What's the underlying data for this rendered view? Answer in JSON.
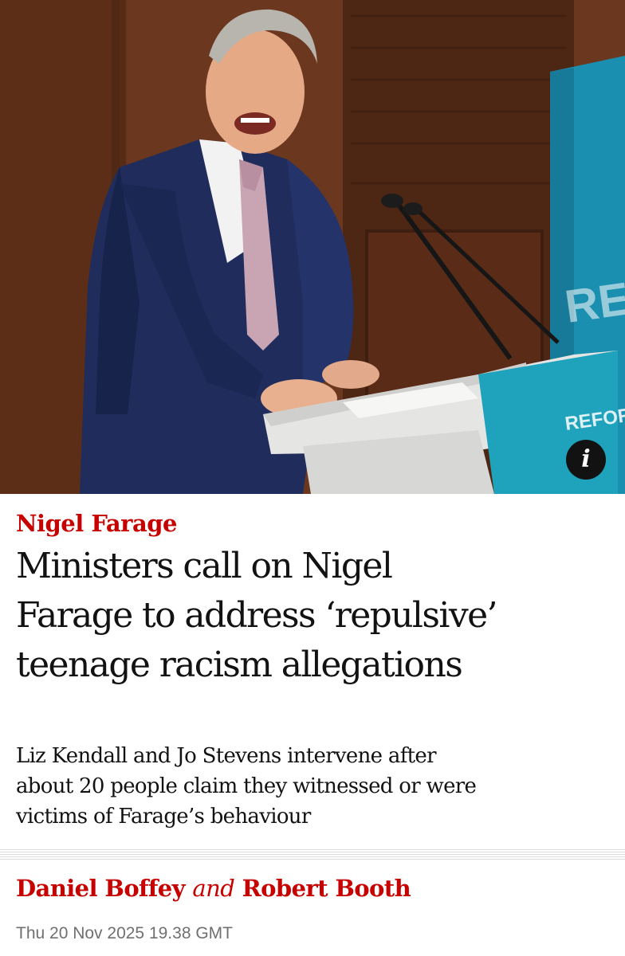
{
  "hero": {
    "podium_text": "REFORMUK",
    "backdrop_text": "REFO",
    "info_label": "i",
    "info_icon": "info-icon"
  },
  "article": {
    "kicker": "Nigel Farage",
    "headline_lines": [
      "Ministers call on Nigel",
      "Farage to address ‘repulsive’",
      "teenage racism allegations"
    ],
    "standfirst_lines": [
      "Liz Kendall and Jo Stevens intervene after",
      "about 20 people claim they witnessed or were",
      "victims of Farage’s behaviour"
    ],
    "byline": {
      "author_1": "Daniel Boffey",
      "joiner": "and",
      "author_2": "Robert Booth"
    },
    "date": "Thu 20 Nov 2025 19.38 GMT"
  },
  "colors": {
    "accent_red": "#c70000",
    "text_main": "#121212",
    "text_meta": "#707070",
    "reform_teal": "#1fa3bd"
  }
}
